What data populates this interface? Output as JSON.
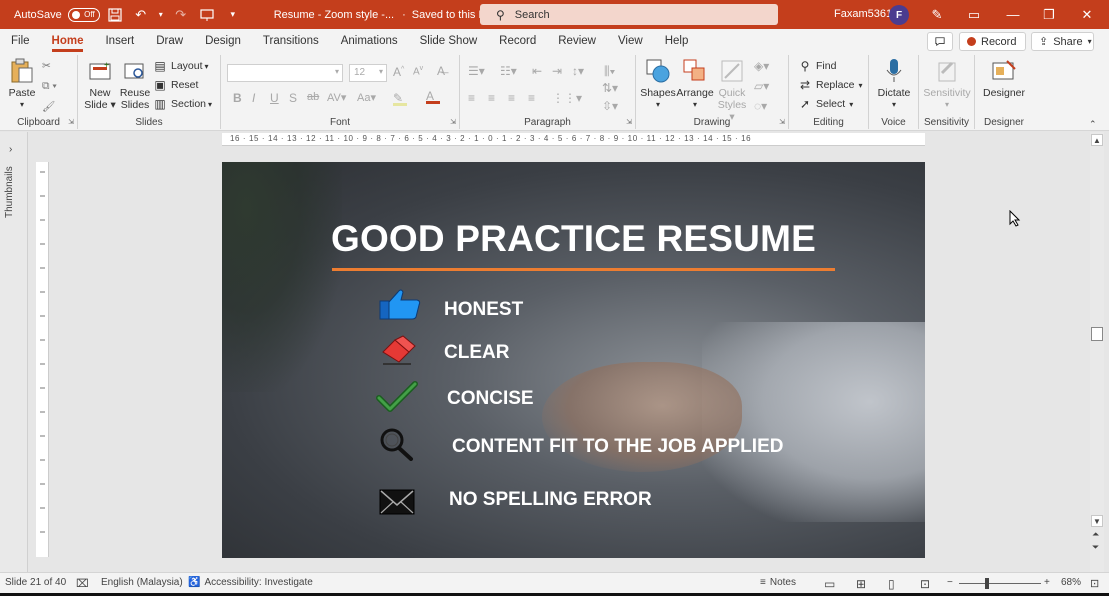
{
  "titlebar": {
    "autosave_label": "AutoSave",
    "autosave_state": "Off",
    "doc_title": "Resume - Zoom style -...",
    "saved_status": "Saved to this PC",
    "search_placeholder": "Search",
    "user_name": "Faxam5361",
    "avatar_initial": "F"
  },
  "tabs": [
    "File",
    "Home",
    "Insert",
    "Draw",
    "Design",
    "Transitions",
    "Animations",
    "Slide Show",
    "Record",
    "Review",
    "View",
    "Help"
  ],
  "active_tab": "Home",
  "tab_actions": {
    "record": "Record",
    "share": "Share"
  },
  "ribbon": {
    "clipboard": {
      "label": "Clipboard",
      "paste": "Paste"
    },
    "slides": {
      "label": "Slides",
      "new_slide_1": "New",
      "new_slide_2": "Slide",
      "reuse_1": "Reuse",
      "reuse_2": "Slides",
      "layout": "Layout",
      "reset": "Reset",
      "section": "Section"
    },
    "font": {
      "label": "Font",
      "size": "12"
    },
    "paragraph": {
      "label": "Paragraph"
    },
    "drawing": {
      "label": "Drawing",
      "shapes": "Shapes",
      "arrange": "Arrange",
      "quick_styles_1": "Quick",
      "quick_styles_2": "Styles"
    },
    "editing": {
      "label": "Editing",
      "find": "Find",
      "replace": "Replace",
      "select": "Select"
    },
    "voice": {
      "label": "Voice",
      "dictate": "Dictate"
    },
    "sensitivity": {
      "label": "Sensitivity",
      "button": "Sensitivity"
    },
    "designer": {
      "label": "Designer",
      "button": "Designer"
    }
  },
  "thumbnails_label": "Thumbnails",
  "ruler_marks": "16 · 15 · 14 · 13 · 12 · 11 · 10 · 9 · 8 · 7 · 6 · 5 · 4 · 3 · 2 · 1 · 0 · 1 · 2 · 3 · 4 · 5 · 6 · 7 · 8 · 9 · 10 · 11 · 12 · 13 · 14 · 15 · 16",
  "slide": {
    "title": "GOOD PRACTICE RESUME",
    "accent_color": "#ed7d31",
    "bullets": [
      {
        "icon": "thumbs-up-icon",
        "text": "HONEST"
      },
      {
        "icon": "eraser-icon",
        "text": "CLEAR"
      },
      {
        "icon": "checkmark-icon",
        "text": "CONCISE"
      },
      {
        "icon": "magnifier-icon",
        "text": "CONTENT FIT TO THE JOB APPLIED"
      },
      {
        "icon": "envelope-icon",
        "text": "NO SPELLING ERROR"
      }
    ]
  },
  "statusbar": {
    "slide_info": "Slide 21 of 40",
    "language": "English (Malaysia)",
    "accessibility": "Accessibility: Investigate",
    "notes": "Notes",
    "zoom": "68%"
  },
  "colors": {
    "brand": "#c43e1c",
    "titlebar_search": "#f3d6cc"
  }
}
